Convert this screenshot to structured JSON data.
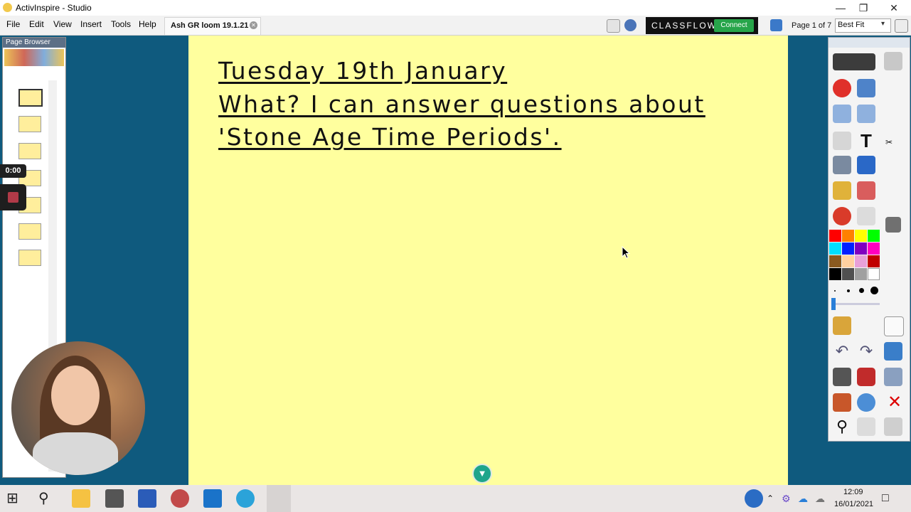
{
  "window": {
    "title": "ActivInspire - Studio"
  },
  "menu": {
    "items": [
      "File",
      "Edit",
      "View",
      "Insert",
      "Tools",
      "Help"
    ]
  },
  "document_tab": {
    "label": "Ash GR loom 19.1.21"
  },
  "classflow": {
    "logo": "CLASSFLOW",
    "connect_label": "Connect"
  },
  "page_indicator": "Page 1 of 7",
  "zoom": {
    "value": "Best Fit"
  },
  "page_browser": {
    "title": "Page Browser",
    "page_count": 7
  },
  "recorder": {
    "timer": "0:00"
  },
  "canvas": {
    "lines": [
      "Tuesday 19th January",
      "What? I can answer questions about",
      "'Stone Age Time Periods'."
    ],
    "background": "#ffff9e"
  },
  "toolbox": {
    "palette": [
      "#ff0000",
      "#ff8000",
      "#ffff00",
      "#00ff00",
      "#00e0ff",
      "#0020ff",
      "#8000c0",
      "#ff00c0",
      "#8a5a20",
      "#ffd0a0",
      "#e8a0d8",
      "#c00000",
      "#000000",
      "#505050",
      "#a0a0a0",
      "#ffffff"
    ]
  },
  "taskbar": {
    "time": "12:09",
    "date": "16/01/2021"
  }
}
